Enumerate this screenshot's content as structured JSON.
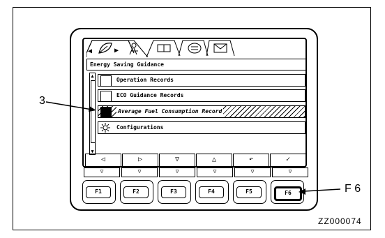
{
  "screen_title": "Energy Saving Guidance",
  "menu_items": [
    {
      "label": "Operation Records",
      "icon": "clipboard-icon",
      "selected": false
    },
    {
      "label": "ECO Guidance Records",
      "icon": "eco-record-icon",
      "selected": false
    },
    {
      "label": "Average Fuel Consumption Record",
      "icon": "fuel-icon",
      "selected": true
    },
    {
      "label": "Configurations",
      "icon": "gear-icon",
      "selected": false
    }
  ],
  "tab_icons": [
    "leaf-icon",
    "person-icon",
    "book-icon",
    "list-icon",
    "envelope-icon"
  ],
  "softkeys": [
    "◁",
    "▷",
    "▽",
    "△",
    "↶",
    "✓"
  ],
  "function_keys": [
    "F1",
    "F2",
    "F3",
    "F4",
    "F5",
    "F6"
  ],
  "key_marks": [
    "▽",
    "▽",
    "▽",
    "▽",
    "▽",
    "▽"
  ],
  "callouts": {
    "item_number": "3",
    "key_label": "F 6"
  },
  "figure_code": "ZZ000074"
}
